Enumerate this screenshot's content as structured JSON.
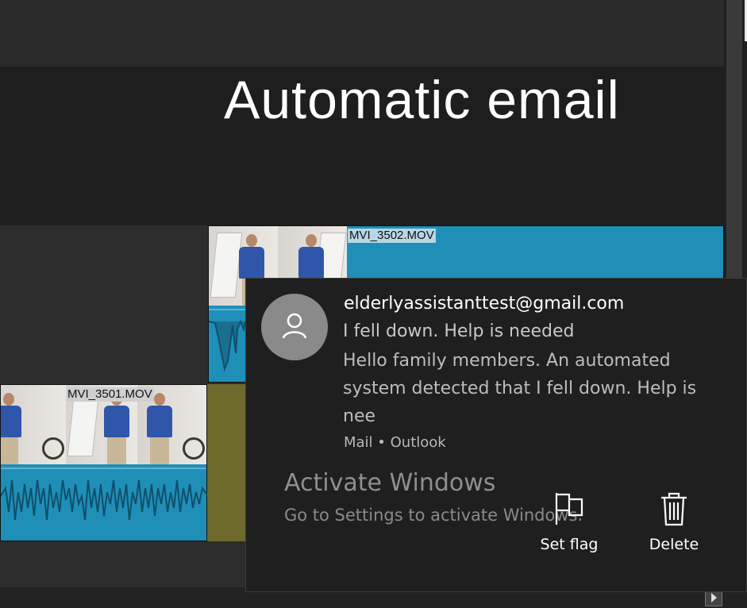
{
  "slide": {
    "title": "Automatic email"
  },
  "clips": [
    {
      "label": "MVI_3502.MOV"
    },
    {
      "label": "MVI_3501.MOV"
    }
  ],
  "notification": {
    "sender": "elderlyassistanttest@gmail.com",
    "subject": "I fell down. Help is needed",
    "body": "Hello family members. An automated system detected that I fell down. Help is nee",
    "attribution": "Mail • Outlook",
    "actions": {
      "set_flag_label": "Set flag",
      "delete_label": "Delete"
    },
    "icons": {
      "avatar": "person-icon",
      "flag": "flag-icon",
      "delete": "trash-icon"
    }
  },
  "watermark": {
    "title": "Activate Windows",
    "subtitle": "Go to Settings to activate Windows."
  },
  "colors": {
    "clip_blue": "#1f8fb8",
    "toast_bg": "#1f1f1f",
    "gap_olive": "#6d6a2b"
  }
}
